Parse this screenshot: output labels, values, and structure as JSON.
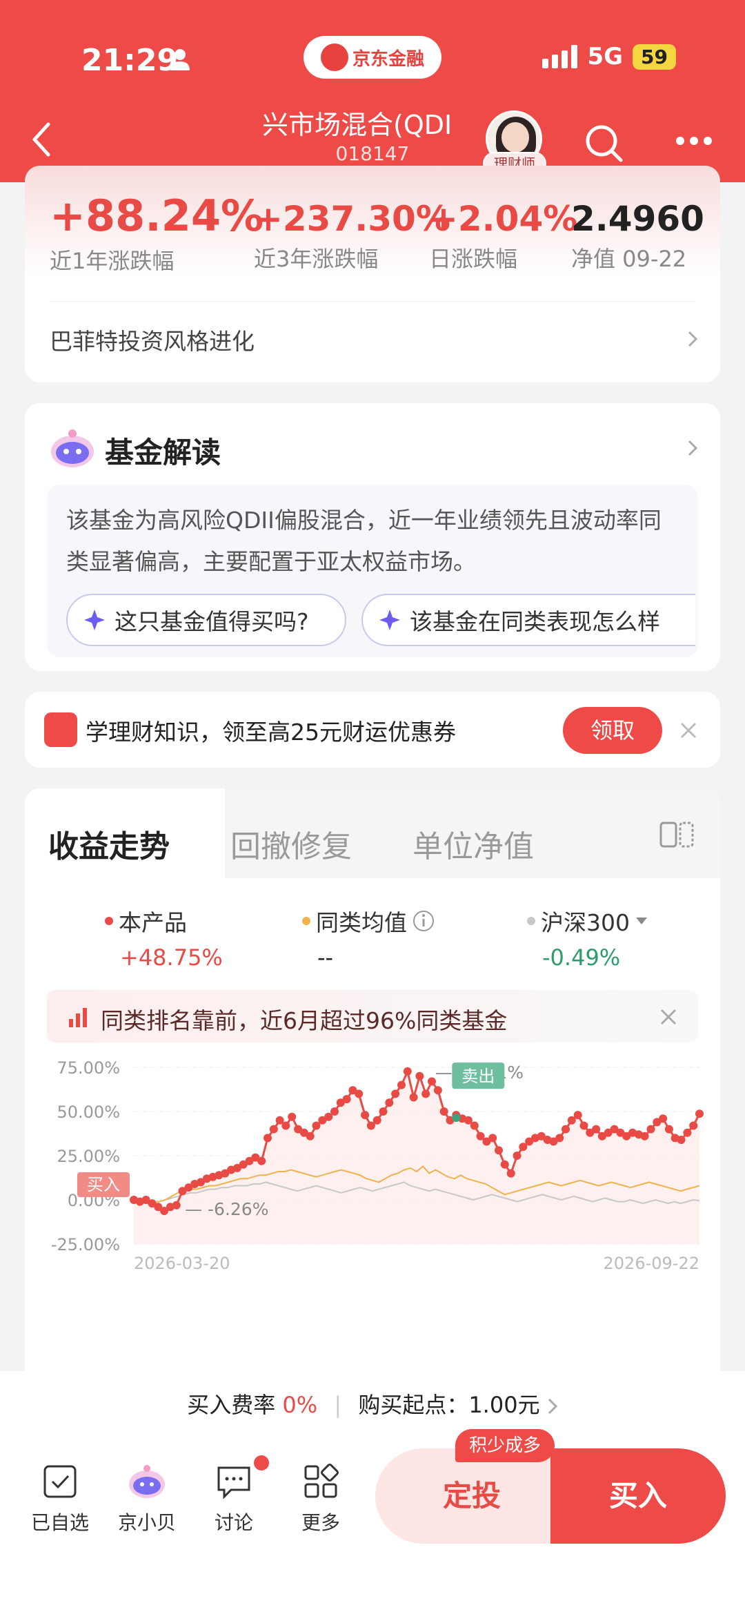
{
  "status_bar": {
    "time": "21:29",
    "network": "5G",
    "battery": "59"
  },
  "header": {
    "brand": "京东金融",
    "fund_title": "兴市场混合(QDI",
    "fund_code": "018147",
    "advisor_label": "理财师"
  },
  "stats": {
    "year_return": {
      "value": "+88.24%",
      "label": "近1年涨跌幅"
    },
    "three_year_return": {
      "value": "+237.30%",
      "label": "近3年涨跌幅"
    },
    "daily_change": {
      "value": "+2.04%",
      "label": "日涨跌幅"
    },
    "nav": {
      "value": "2.4960",
      "label": "净值 09-22"
    },
    "style_text": "巴菲特投资风格进化"
  },
  "interpret": {
    "title": "基金解读",
    "text": "该基金为高风险QDII偏股混合，近一年业绩领先且波动率同类显著偏高，主要配置于亚太权益市场。",
    "questions": [
      "这只基金值得买吗?",
      "该基金在同类表现怎么样"
    ]
  },
  "promo": {
    "text": "学理财知识，领至高25元财运优惠券",
    "button": "领取"
  },
  "chart_section": {
    "tabs": [
      "收益走势",
      "回撤修复",
      "单位净值"
    ],
    "legend": [
      {
        "name": "本产品",
        "value": "+48.75%",
        "color": "#e84a45"
      },
      {
        "name": "同类均值",
        "value": "--",
        "color": "#f0b24c"
      },
      {
        "name": "沪深300",
        "value": "-0.49%",
        "color": "#c8c8c8"
      }
    ],
    "rank_text": "同类排名靠前，近6月超过96%同类基金",
    "buy_label": "买入",
    "sell_label": "卖出",
    "max_label": "— 72.71%",
    "min_label": "— -6.26%"
  },
  "chart_data": {
    "type": "line",
    "yticks": [
      "75.00%",
      "50.00%",
      "25.00%",
      "0.00%",
      "-25.00%"
    ],
    "ylim": [
      -25,
      75
    ],
    "xlabels": [
      "2026-03-20",
      "2026-09-22"
    ],
    "series": [
      {
        "name": "本产品",
        "color": "#e84a45",
        "values": [
          0,
          -1,
          0,
          -2,
          -4,
          -6.26,
          -4,
          -3,
          5,
          7,
          9,
          10,
          12,
          13,
          14,
          15,
          17,
          18,
          20,
          22,
          24,
          22,
          35,
          40,
          45,
          42,
          47,
          40,
          38,
          36,
          42,
          45,
          47,
          50,
          55,
          57,
          62,
          60,
          48,
          42,
          45,
          50,
          55,
          60,
          65,
          72.71,
          58,
          70,
          60,
          67,
          62,
          50,
          45,
          48,
          46,
          45,
          42,
          36,
          33,
          35,
          28,
          20,
          15,
          25,
          30,
          33,
          35,
          36,
          34,
          33,
          35,
          40,
          45,
          48,
          42,
          38,
          40,
          36,
          38,
          40,
          38,
          36,
          38,
          37,
          36,
          40,
          44,
          46,
          40,
          35,
          34,
          38,
          42,
          48.75
        ]
      },
      {
        "name": "同类均值",
        "color": "#f0b24c",
        "values": [
          0,
          -1,
          -2,
          -1,
          -1,
          0,
          2,
          4,
          5,
          6,
          6,
          7,
          8,
          8,
          9,
          10,
          11,
          12,
          12,
          13,
          14,
          14,
          15,
          16,
          16,
          17,
          16,
          15,
          14,
          13,
          14,
          15,
          16,
          17,
          16,
          15,
          14,
          12,
          11,
          10,
          12,
          14,
          15,
          17,
          18,
          16,
          19,
          15,
          17,
          15,
          13,
          12,
          14,
          12,
          11,
          10,
          9,
          7,
          5,
          3,
          4,
          5,
          6,
          7,
          8,
          9,
          10,
          9,
          8,
          9,
          10,
          11,
          10,
          9,
          8,
          9,
          10,
          9,
          8,
          7,
          8,
          9,
          10,
          9,
          8,
          7,
          6,
          5,
          6,
          7,
          8
        ]
      },
      {
        "name": "沪深300",
        "color": "#c8c8c8",
        "values": [
          0,
          -1,
          -2,
          -2,
          -1,
          0,
          1,
          2,
          3,
          4,
          4,
          5,
          6,
          6,
          7,
          7,
          8,
          8,
          8,
          9,
          9,
          10,
          9,
          8,
          7,
          6,
          5,
          6,
          7,
          8,
          7,
          6,
          5,
          4,
          5,
          6,
          7,
          6,
          5,
          6,
          7,
          8,
          9,
          10,
          8,
          7,
          6,
          5,
          6,
          5,
          4,
          3,
          2,
          1,
          0,
          1,
          2,
          3,
          2,
          1,
          0,
          -1,
          0,
          1,
          2,
          3,
          2,
          1,
          0,
          1,
          2,
          1,
          0,
          -1,
          0,
          1,
          0,
          -1,
          -1,
          0,
          -1,
          -2,
          -1,
          0,
          -1,
          -2,
          -1,
          -2,
          -1,
          0,
          -0.49
        ]
      }
    ]
  },
  "bottom": {
    "fee_label": "买入费率",
    "fee_value": "0%",
    "min_purchase": "购买起点：1.00元",
    "nav": [
      "已自选",
      "京小贝",
      "讨论",
      "更多"
    ],
    "fixed_badge": "积少成多",
    "fixed_invest": "定投",
    "buy": "买入"
  }
}
